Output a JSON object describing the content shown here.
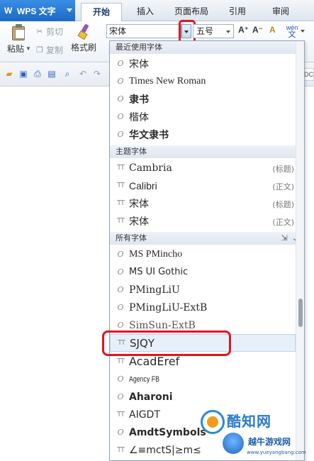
{
  "app": {
    "name": "WPS 文字"
  },
  "tabs": [
    "开始",
    "插入",
    "页面布局",
    "引用",
    "审阅"
  ],
  "ribbon": {
    "paste": "粘贴",
    "cut": "剪切",
    "copy": "复制",
    "format_painter": "格式刷",
    "font_name": "宋体",
    "font_size": "五号",
    "grow_font": "A⁺",
    "shrink_font": "A⁻",
    "clear_format": "A",
    "wen_top": "wén",
    "wen_bottom": "文"
  },
  "doc_edge_text": "DC",
  "dropdown": {
    "sections": {
      "recent": "最近使用字体",
      "theme": "主题字体",
      "all": "所有字体"
    },
    "recent_fonts": [
      "宋体",
      "Times New Roman",
      "隶书",
      "楷体",
      "华文隶书"
    ],
    "theme_fonts": [
      {
        "name": "Cambria",
        "tag": "(标题)"
      },
      {
        "name": "Calibri",
        "tag": "(正文)"
      },
      {
        "name": "宋体",
        "tag": "(标题)"
      },
      {
        "name": "宋体",
        "tag": "(正文)"
      }
    ],
    "all_fonts": [
      "MS PMincho",
      "MS UI Gothic",
      "PMingLiU",
      "PMingLiU-ExtB",
      "SimSun-ExtB",
      "SJQY",
      "AcadEref",
      "Agency FB",
      "Aharoni",
      "AIGDT",
      "AmdtSymbols",
      "∠≡mctS|≥m≤"
    ],
    "selected_font": "SJQY",
    "icon_opentype": "O",
    "icon_truetype": "TT"
  },
  "watermark": {
    "brand": "酷知网",
    "sub": "越牛游戏网",
    "url": "www.yueyangbang.com"
  },
  "colors": {
    "accent": "#1c69c4",
    "highlight": "#e0161f",
    "selection": "#e7f0fa"
  }
}
